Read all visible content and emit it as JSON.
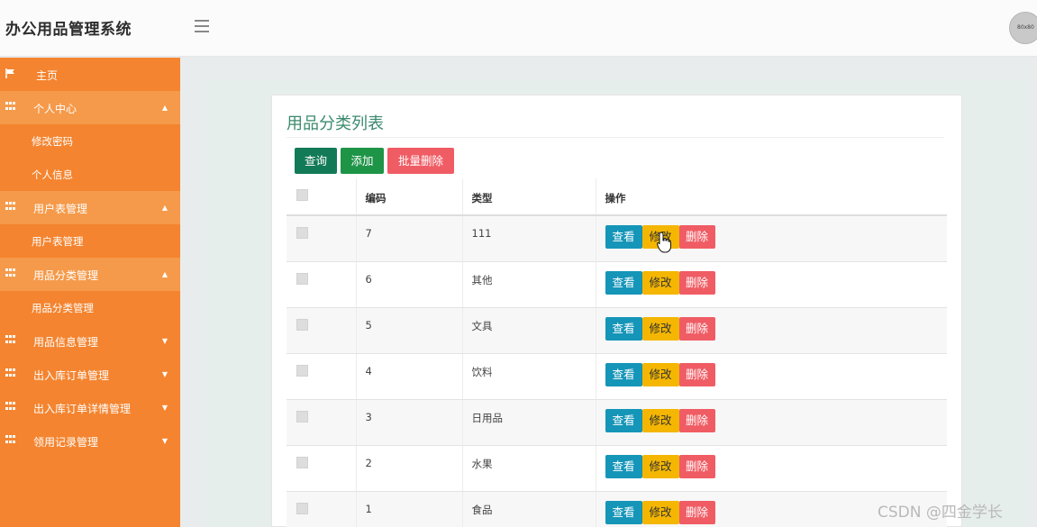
{
  "app": {
    "title": "办公用品管理系统",
    "avatar_text": "80x80"
  },
  "sidebar": {
    "items": [
      {
        "label": "主页",
        "kind": "home",
        "icon": "flag-icon"
      },
      {
        "label": "个人中心",
        "kind": "group",
        "open": true,
        "icon": "grid-icon"
      },
      {
        "label": "修改密码",
        "kind": "sub"
      },
      {
        "label": "个人信息",
        "kind": "sub"
      },
      {
        "label": "用户表管理",
        "kind": "group",
        "open": true,
        "icon": "grid-icon"
      },
      {
        "label": "用户表管理",
        "kind": "sub"
      },
      {
        "label": "用品分类管理",
        "kind": "group",
        "open": true,
        "icon": "grid-icon"
      },
      {
        "label": "用品分类管理",
        "kind": "sub"
      },
      {
        "label": "用品信息管理",
        "kind": "group",
        "open": false,
        "icon": "grid-icon"
      },
      {
        "label": "出入库订单管理",
        "kind": "group",
        "open": false,
        "icon": "grid-icon"
      },
      {
        "label": "出入库订单详情管理",
        "kind": "group",
        "open": false,
        "icon": "grid-icon"
      },
      {
        "label": "领用记录管理",
        "kind": "group",
        "open": false,
        "icon": "grid-icon"
      }
    ]
  },
  "main": {
    "title": "用品分类列表",
    "toolbar": {
      "query_label": "查询",
      "add_label": "添加",
      "batch_delete_label": "批量删除"
    },
    "table": {
      "headers": {
        "id": "编码",
        "type": "类型",
        "ops": "操作"
      },
      "row_actions": {
        "view": "查看",
        "edit": "修改",
        "delete": "删除"
      },
      "rows": [
        {
          "id": "7",
          "type": "111"
        },
        {
          "id": "6",
          "type": "其他"
        },
        {
          "id": "5",
          "type": "文具"
        },
        {
          "id": "4",
          "type": "饮料"
        },
        {
          "id": "3",
          "type": "日用品"
        },
        {
          "id": "2",
          "type": "水果"
        },
        {
          "id": "1",
          "type": "食品"
        }
      ]
    }
  },
  "watermark": "CSDN @四金学长",
  "colors": {
    "sidebar": "#f4842f",
    "sidebar_open": "#f59a4a",
    "query": "#137a58",
    "add": "#1e9447",
    "danger": "#f05c64",
    "view": "#1595b8",
    "edit": "#f4b600",
    "title": "#3a8a6d"
  }
}
